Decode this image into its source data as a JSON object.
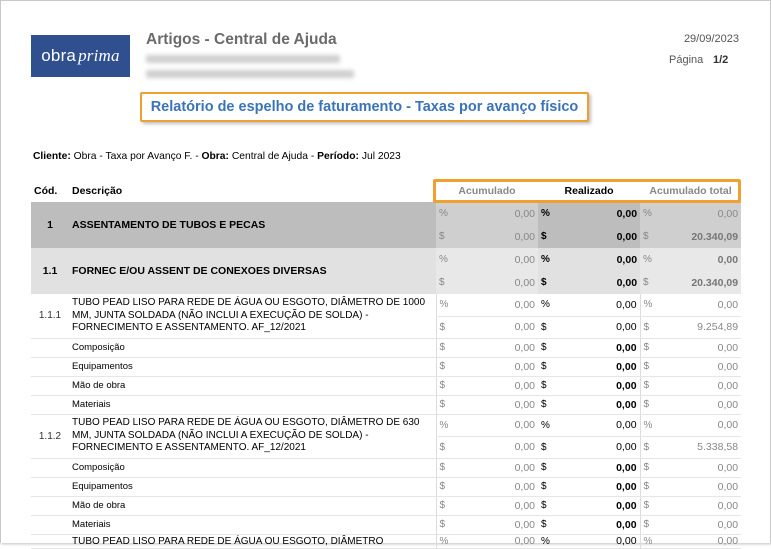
{
  "header": {
    "logo_text_a": "obra",
    "logo_text_b": "prima",
    "title": "Artigos - Central de Ajuda",
    "date": "29/09/2023",
    "page_label": "Página",
    "page_number": "1/2"
  },
  "report_title": "Relatório de espelho de faturamento - Taxas por avanço físico",
  "client": {
    "client_label": "Cliente:",
    "client_value": "Obra - Taxa por Avanço F.",
    "sep1": "-",
    "obra_label": "Obra:",
    "obra_value": "Central de Ajuda",
    "sep2": "-",
    "period_label": "Período:",
    "period_value": "Jul 2023"
  },
  "columns": {
    "code": "Cód.",
    "description": "Descrição",
    "accumulated": "Acumulado",
    "realized": "Realizado",
    "accumulated_total": "Acumulado total"
  },
  "symbols": {
    "pct": "%",
    "cur": "$"
  },
  "rows": {
    "r1": {
      "code": "1",
      "desc": "ASSENTAMENTO DE TUBOS E PECAS",
      "acum_pct": "0,00",
      "acum_cur": "0,00",
      "real_pct": "0,00",
      "real_cur": "0,00",
      "tot_pct": "0,00",
      "tot_cur": "20.340,09"
    },
    "r11": {
      "code": "1.1",
      "desc": "FORNEC E/OU ASSENT DE CONEXOES DIVERSAS",
      "acum_pct": "0,00",
      "acum_cur": "0,00",
      "real_pct": "0,00",
      "real_cur": "0,00",
      "tot_pct": "0,00",
      "tot_cur": "20.340,09"
    },
    "r111": {
      "code": "1.1.1",
      "desc": "TUBO PEAD LISO PARA REDE DE ÁGUA OU ESGOTO, DIÂMETRO DE 1000 MM, JUNTA SOLDADA (NÃO INCLUI A EXECUÇÃO DE SOLDA) - FORNECIMENTO E ASSENTAMENTO. AF_12/2021",
      "acum_pct": "0,00",
      "acum_cur": "0,00",
      "real_pct": "0,00",
      "real_cur": "0,00",
      "tot_pct": "0,00",
      "tot_cur": "9.254,89"
    },
    "r112": {
      "code": "1.1.2",
      "desc": "TUBO PEAD LISO PARA REDE DE ÁGUA OU ESGOTO, DIÂMETRO DE 630 MM, JUNTA SOLDADA (NÃO INCLUI A EXECUÇÃO DE SOLDA) - FORNECIMENTO E ASSENTAMENTO. AF_12/2021",
      "acum_pct": "0,00",
      "acum_cur": "0,00",
      "real_pct": "0,00",
      "real_cur": "0,00",
      "tot_pct": "0,00",
      "tot_cur": "5.338,58"
    },
    "r113": {
      "desc": "TUBO PEAD LISO PARA REDE DE ÁGUA OU ESGOTO, DIÂMETRO",
      "acum_pct": "0,00",
      "real_pct": "0,00",
      "tot_pct": "0,00"
    },
    "sub_a": [
      {
        "desc": "Composição",
        "acum": "0,00",
        "real": "0,00",
        "tot": "0,00"
      },
      {
        "desc": "Equipamentos",
        "acum": "0,00",
        "real": "0,00",
        "tot": "0,00"
      },
      {
        "desc": "Mão de obra",
        "acum": "0,00",
        "real": "0,00",
        "tot": "0,00"
      },
      {
        "desc": "Materiais",
        "acum": "0,00",
        "real": "0,00",
        "tot": "0,00"
      }
    ],
    "sub_b": [
      {
        "desc": "Composição",
        "acum": "0,00",
        "real": "0,00",
        "tot": "0,00"
      },
      {
        "desc": "Equipamentos",
        "acum": "0,00",
        "real": "0,00",
        "tot": "0,00"
      },
      {
        "desc": "Mão de obra",
        "acum": "0,00",
        "real": "0,00",
        "tot": "0,00"
      },
      {
        "desc": "Materiais",
        "acum": "0,00",
        "real": "0,00",
        "tot": "0,00"
      }
    ]
  }
}
